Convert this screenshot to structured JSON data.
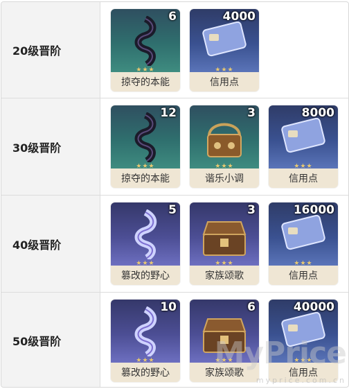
{
  "rows": [
    {
      "label": "20级晋阶",
      "items": [
        {
          "name": "掠夺的本能",
          "qty": "6",
          "icon": "scroll-dark-icon",
          "theme": "teal"
        },
        {
          "name": "信用点",
          "qty": "4000",
          "icon": "credit-card-icon",
          "theme": "blue"
        }
      ]
    },
    {
      "label": "30级晋阶",
      "items": [
        {
          "name": "掠夺的本能",
          "qty": "12",
          "icon": "scroll-dark-icon",
          "theme": "teal"
        },
        {
          "name": "谐乐小调",
          "qty": "3",
          "icon": "music-box-icon",
          "theme": "teal"
        },
        {
          "name": "信用点",
          "qty": "8000",
          "icon": "credit-card-icon",
          "theme": "blue"
        }
      ]
    },
    {
      "label": "40级晋阶",
      "items": [
        {
          "name": "篡改的野心",
          "qty": "5",
          "icon": "scroll-light-icon",
          "theme": "purple"
        },
        {
          "name": "家族颂歌",
          "qty": "3",
          "icon": "treasure-chest-icon",
          "theme": "purple"
        },
        {
          "name": "信用点",
          "qty": "16000",
          "icon": "credit-card-icon",
          "theme": "blue"
        }
      ]
    },
    {
      "label": "50级晋阶",
      "items": [
        {
          "name": "篡改的野心",
          "qty": "10",
          "icon": "scroll-light-icon",
          "theme": "purple"
        },
        {
          "name": "家族颂歌",
          "qty": "6",
          "icon": "treasure-chest-icon",
          "theme": "purple"
        },
        {
          "name": "信用点",
          "qty": "40000",
          "icon": "credit-card-icon",
          "theme": "blue"
        }
      ]
    }
  ],
  "stars_glyph": "★★★",
  "watermark": "MyPrice",
  "watermark_url": "myprice.com.cn"
}
